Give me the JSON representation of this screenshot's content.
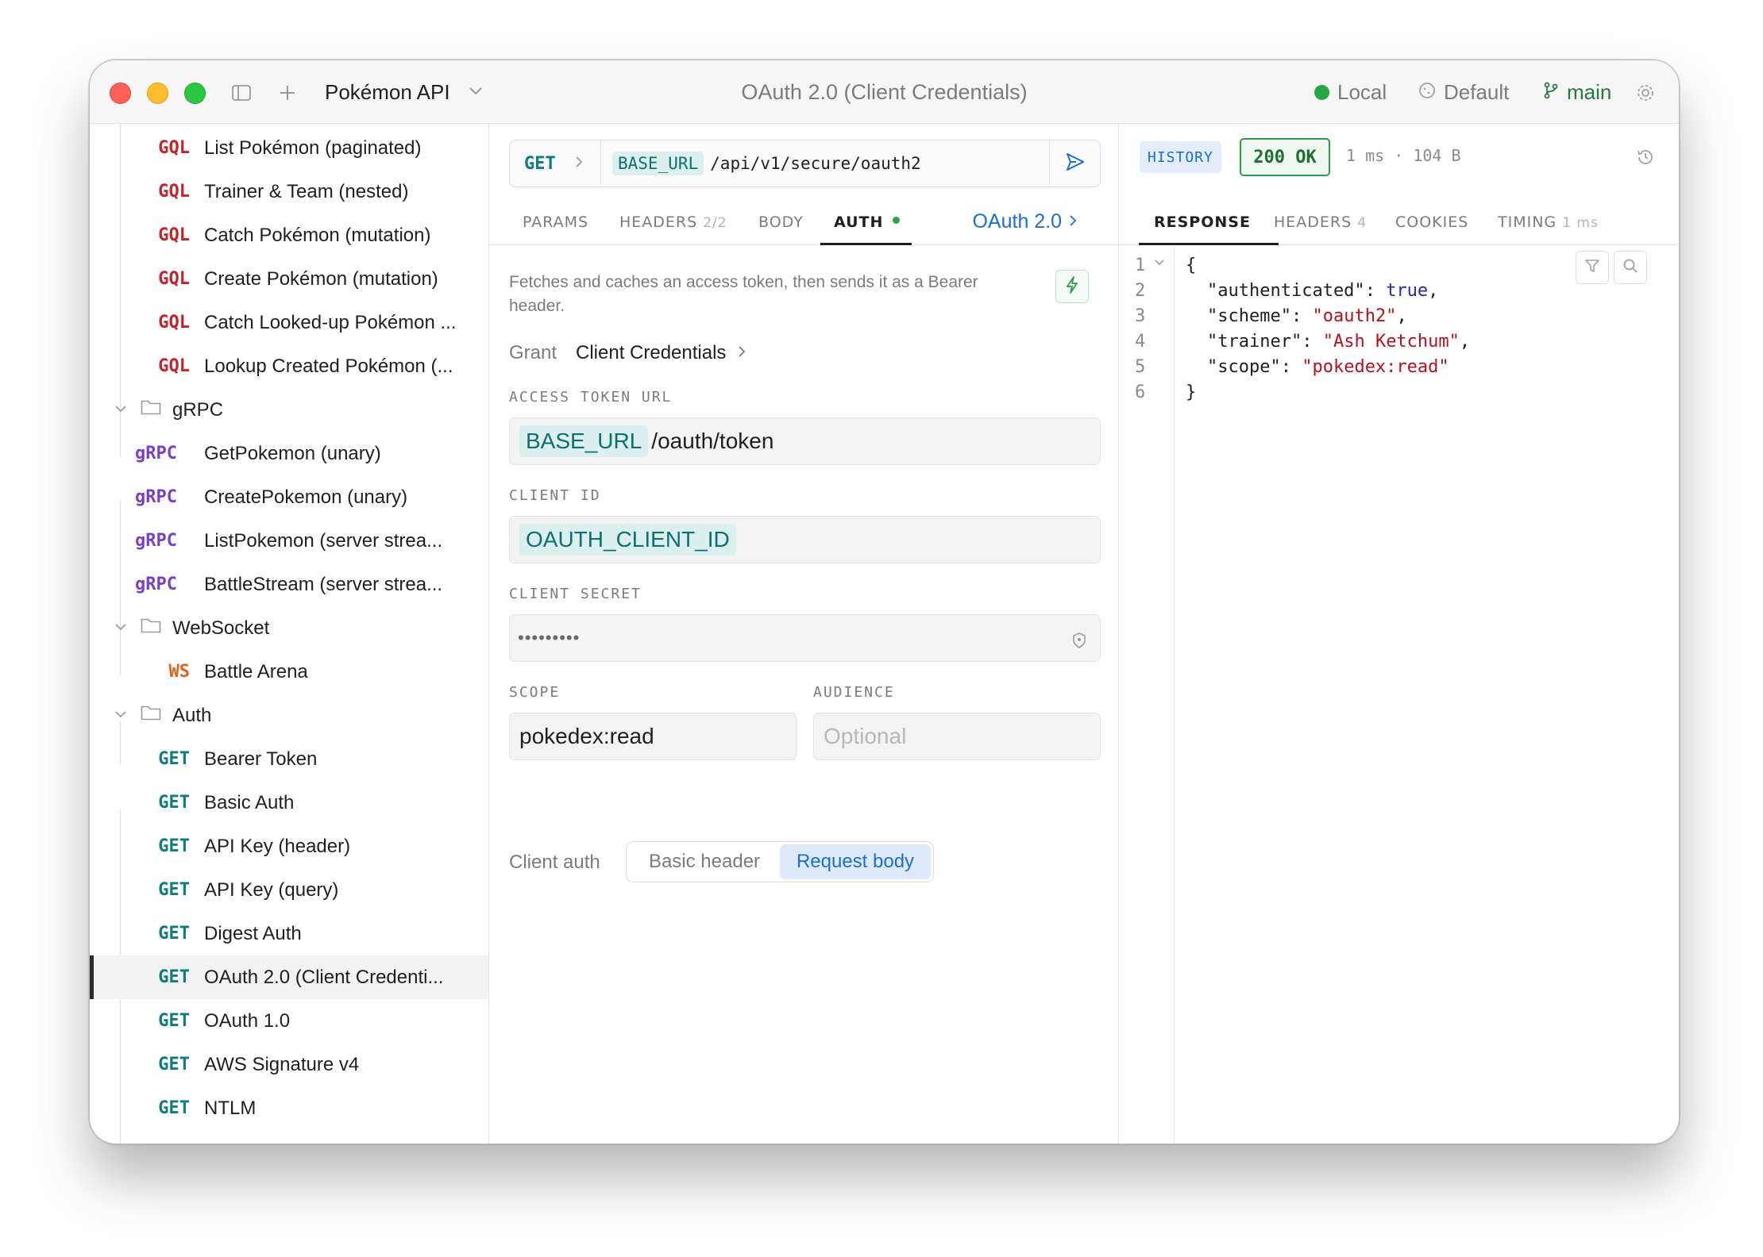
{
  "titlebar": {
    "workspace": "Pokémon API",
    "title": "OAuth 2.0 (Client Credentials)",
    "environment": "Local",
    "profile": "Default",
    "branch": "main"
  },
  "sidebar": {
    "items": [
      {
        "method": "GQL",
        "label": "List Pokémon (paginated)"
      },
      {
        "method": "GQL",
        "label": "Trainer & Team (nested)"
      },
      {
        "method": "GQL",
        "label": "Catch Pokémon (mutation)"
      },
      {
        "method": "GQL",
        "label": "Create Pokémon (mutation)"
      },
      {
        "method": "GQL",
        "label": "Catch Looked-up Pokémon ..."
      },
      {
        "method": "GQL",
        "label": "Lookup Created Pokémon (..."
      },
      {
        "folder": "gRPC"
      },
      {
        "method": "gRPC",
        "label": "GetPokemon (unary)"
      },
      {
        "method": "gRPC",
        "label": "CreatePokemon (unary)"
      },
      {
        "method": "gRPC",
        "label": "ListPokemon (server strea..."
      },
      {
        "method": "gRPC",
        "label": "BattleStream (server strea..."
      },
      {
        "folder": "WebSocket"
      },
      {
        "method": "WS",
        "label": "Battle Arena"
      },
      {
        "folder": "Auth"
      },
      {
        "method": "GET",
        "label": "Bearer Token"
      },
      {
        "method": "GET",
        "label": "Basic Auth"
      },
      {
        "method": "GET",
        "label": "API Key (header)"
      },
      {
        "method": "GET",
        "label": "API Key (query)"
      },
      {
        "method": "GET",
        "label": "Digest Auth"
      },
      {
        "method": "GET",
        "label": "OAuth 2.0 (Client Credenti...",
        "selected": true
      },
      {
        "method": "GET",
        "label": "OAuth 1.0"
      },
      {
        "method": "GET",
        "label": "AWS Signature v4"
      },
      {
        "method": "GET",
        "label": "NTLM"
      }
    ]
  },
  "request": {
    "method": "GET",
    "url_var": "BASE_URL",
    "url_path": "/api/v1/secure/oauth2",
    "tabs": {
      "params": "PARAMS",
      "headers": "HEADERS",
      "headers_count": "2/2",
      "body": "BODY",
      "auth": "AUTH"
    },
    "auth_type": "OAuth 2.0",
    "description": "Fetches and caches an access token, then sends it as a Bearer header.",
    "grant_label": "Grant",
    "grant_value": "Client Credentials",
    "access_token_url": {
      "label": "ACCESS TOKEN URL",
      "var": "BASE_URL",
      "path": "/oauth/token"
    },
    "client_id": {
      "label": "CLIENT ID",
      "var": "OAUTH_CLIENT_ID"
    },
    "client_secret": {
      "label": "CLIENT SECRET",
      "value": "•••••••••"
    },
    "scope": {
      "label": "SCOPE",
      "value": "pokedex:read"
    },
    "audience": {
      "label": "AUDIENCE",
      "placeholder": "Optional"
    },
    "client_auth": {
      "label": "Client auth",
      "options": [
        "Basic header",
        "Request body"
      ],
      "selected": "Request body"
    }
  },
  "response": {
    "history": "HISTORY",
    "status": "200 OK",
    "meta": "1 ms · 104 B",
    "tabs": {
      "response": "RESPONSE",
      "headers": "HEADERS",
      "headers_count": "4",
      "cookies": "COOKIES",
      "timing": "TIMING",
      "timing_value": "1 ms"
    },
    "line_numbers": [
      "1",
      "2",
      "3",
      "4",
      "5",
      "6"
    ],
    "body": {
      "open": "{",
      "k1": "\"authenticated\"",
      "v1": "true",
      "k2": "\"scheme\"",
      "v2": "\"oauth2\"",
      "k3": "\"trainer\"",
      "v3": "\"Ash Ketchum\"",
      "k4": "\"scope\"",
      "v4": "\"pokedex:read\"",
      "close": "}"
    }
  },
  "colors": {
    "accent": "#1a6fd1",
    "gql": "#c4232b",
    "grpc": "#7a3fc2",
    "ws": "#e0631a",
    "get": "#0e7b7e",
    "status_ok": "#2f9a4a"
  }
}
